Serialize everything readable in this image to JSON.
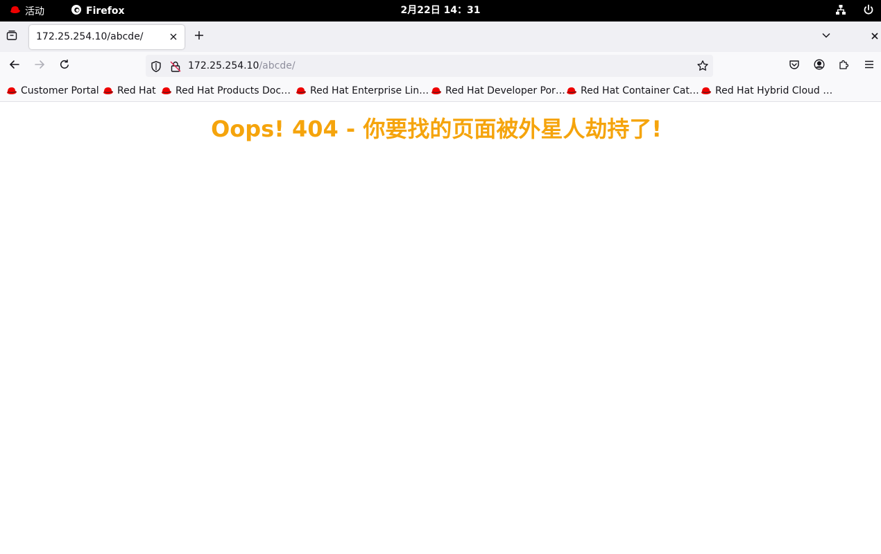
{
  "top_bar": {
    "activities_label": "活动",
    "app_name": "Firefox",
    "clock": "2月22日 14：31",
    "icons": [
      "redhat-icon",
      "firefox-icon",
      "network-icon",
      "power-icon"
    ]
  },
  "browser": {
    "tab": {
      "title": "172.25.254.10/abcde/"
    },
    "url": {
      "host": "172.25.254.10",
      "path": "/abcde/"
    },
    "bookmarks": [
      "Customer Portal",
      "Red Hat",
      "Red Hat Products Doc…",
      "Red Hat Enterprise Lin…",
      "Red Hat Developer Por…",
      "Red Hat Container Cat…",
      "Red Hat Hybrid Cloud …"
    ]
  },
  "page": {
    "heading": "Oops! 404 - 你要找的页面被外星人劫持了!"
  },
  "colors": {
    "heading": "#f5a40c",
    "redhat": "#ee0000",
    "topbar": "#000000"
  }
}
